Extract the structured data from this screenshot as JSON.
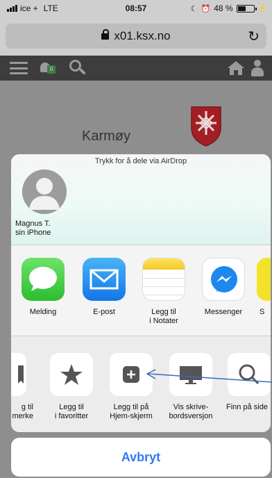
{
  "status_bar": {
    "carrier": "ice +",
    "network": "LTE",
    "time": "08:57",
    "battery": "48 %"
  },
  "browser": {
    "url": "x01.ksx.no",
    "reload_icon": "reload-icon"
  },
  "site": {
    "name": "Karmøy",
    "notification_badge": "0"
  },
  "share_sheet": {
    "airdrop_hint": "Trykk for å dele via AirDrop",
    "contact": {
      "name": "Magnus T.\nsin iPhone"
    },
    "apps": [
      {
        "label": "Melding",
        "icon": "messages-icon"
      },
      {
        "label": "E-post",
        "icon": "mail-icon"
      },
      {
        "label": "Legg til\ni Notater",
        "icon": "notes-icon"
      },
      {
        "label": "Messenger",
        "icon": "messenger-icon"
      },
      {
        "label": "S",
        "icon": "app-icon"
      }
    ],
    "actions": [
      {
        "label": "g til\nmerke",
        "icon": "bookmark-icon"
      },
      {
        "label": "Legg til\ni favoritter",
        "icon": "star-icon"
      },
      {
        "label": "Legg til på\nHjem-skjerm",
        "icon": "add-to-home-icon"
      },
      {
        "label": "Vis skrive-\nbordsversjon",
        "icon": "desktop-icon"
      },
      {
        "label": "Finn på side",
        "icon": "search-icon"
      }
    ],
    "cancel_label": "Avbryt"
  },
  "colors": {
    "accent": "#3478f6",
    "annotation_arrow": "#2f6fb5"
  }
}
